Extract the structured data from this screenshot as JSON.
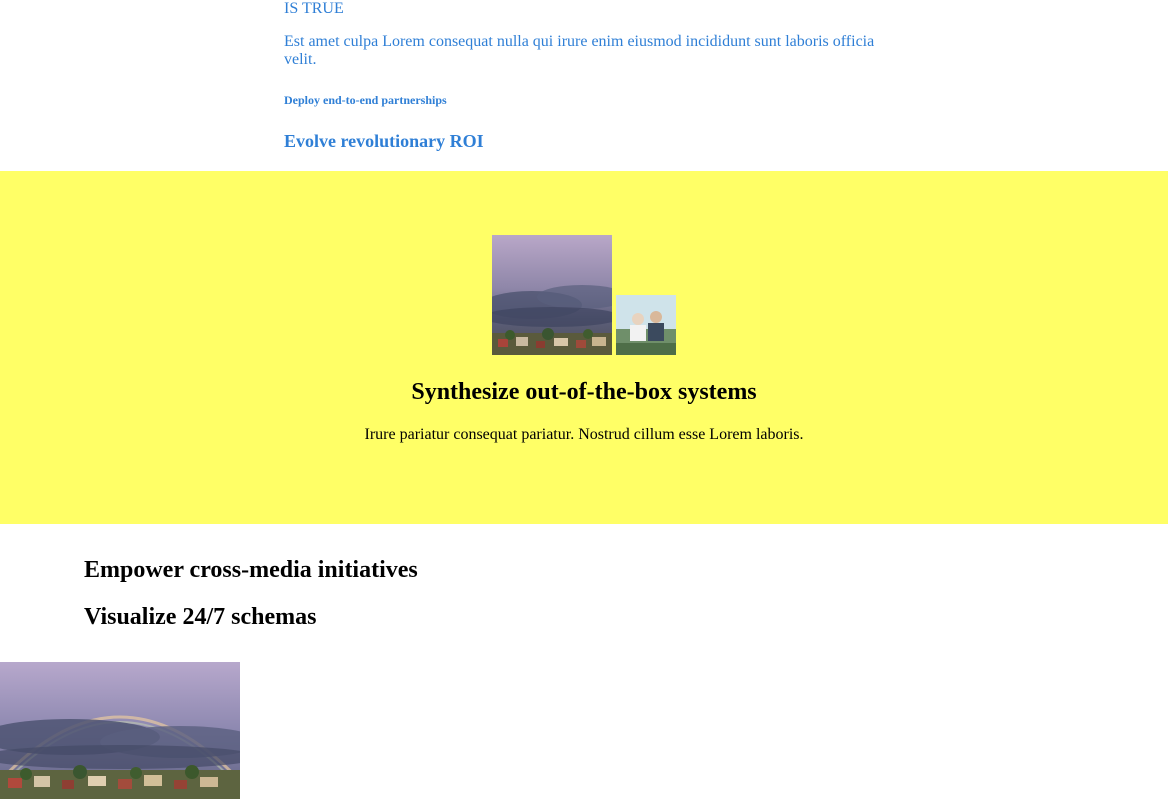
{
  "top_section": {
    "truth_line": "IS TRUE",
    "paragraph": "Est amet culpa Lorem consequat nulla qui irure enim eiusmod incididunt sunt laboris officia velit.",
    "small_heading": "Deploy end-to-end partnerships",
    "subheading": "Evolve revolutionary ROI"
  },
  "feature_band": {
    "background_color": "#ffff66",
    "title": "Synthesize out-of-the-box systems",
    "text": "Irure pariatur consequat pariatur. Nostrud cillum esse Lorem laboris."
  },
  "headings": {
    "first": "Empower cross-media initiatives",
    "second": "Visualize 24/7 schemas"
  },
  "colors": {
    "link_blue": "#2f7fd6",
    "band_yellow": "#ffff66",
    "text_black": "#000000"
  }
}
